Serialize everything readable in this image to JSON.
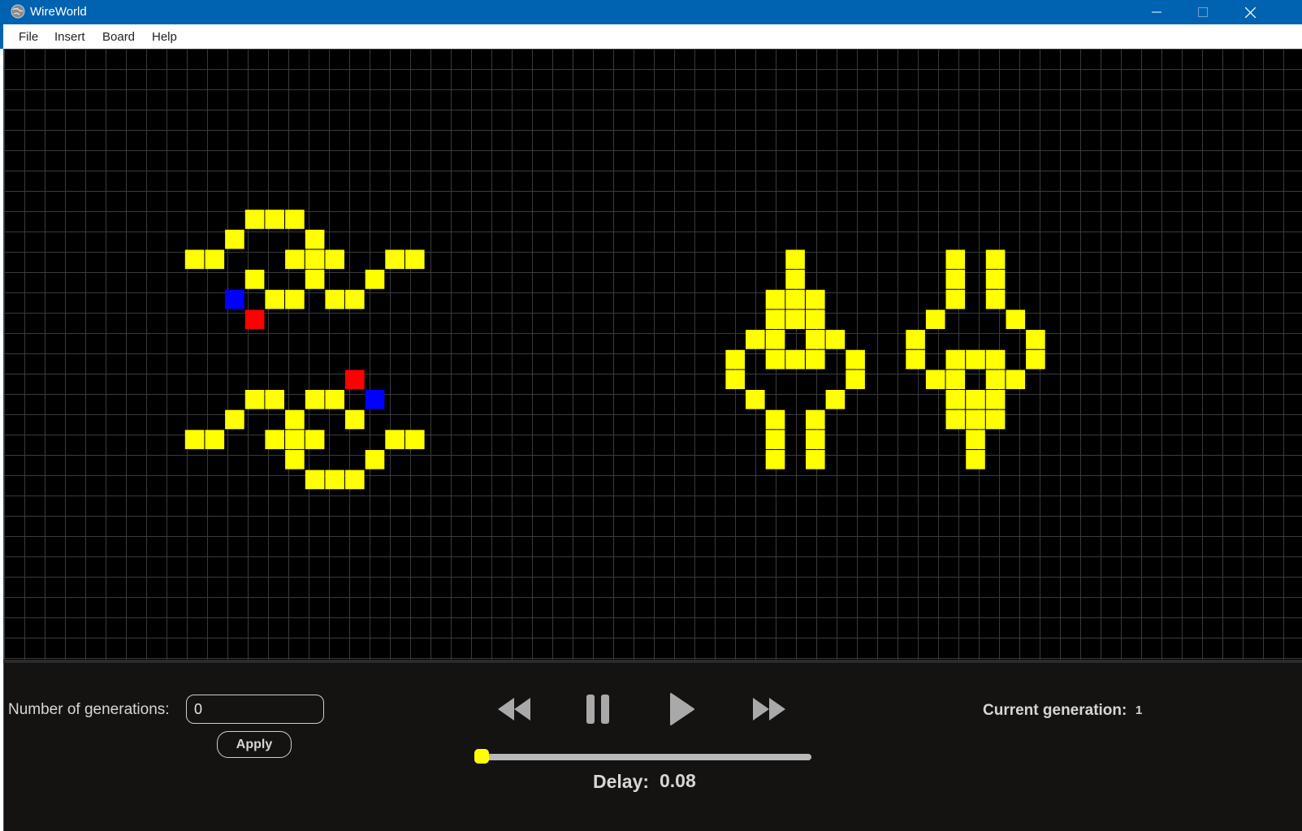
{
  "window": {
    "title": "WireWorld",
    "icon": "globe-icon",
    "controls": [
      "minimize-icon",
      "maximize-icon",
      "close-icon"
    ]
  },
  "menu": {
    "items": [
      {
        "label": "File"
      },
      {
        "label": "Insert"
      },
      {
        "label": "Board"
      },
      {
        "label": "Help"
      }
    ]
  },
  "board": {
    "colors": {
      "background": "#000000",
      "grid": "#3a3a3a",
      "conductor": "#ffff00",
      "electron_head": "#0000ff",
      "electron_tail": "#ff0000"
    },
    "conductor": [
      [
        12,
        8
      ],
      [
        13,
        8
      ],
      [
        14,
        8
      ],
      [
        11,
        9
      ],
      [
        15,
        9
      ],
      [
        9,
        10
      ],
      [
        10,
        10
      ],
      [
        14,
        10
      ],
      [
        15,
        10
      ],
      [
        16,
        10
      ],
      [
        19,
        10
      ],
      [
        20,
        10
      ],
      [
        12,
        11
      ],
      [
        15,
        11
      ],
      [
        18,
        11
      ],
      [
        13,
        12
      ],
      [
        14,
        12
      ],
      [
        16,
        12
      ],
      [
        17,
        12
      ],
      [
        12,
        17
      ],
      [
        13,
        17
      ],
      [
        15,
        17
      ],
      [
        16,
        17
      ],
      [
        11,
        18
      ],
      [
        14,
        18
      ],
      [
        17,
        18
      ],
      [
        9,
        19
      ],
      [
        10,
        19
      ],
      [
        13,
        19
      ],
      [
        14,
        19
      ],
      [
        15,
        19
      ],
      [
        19,
        19
      ],
      [
        20,
        19
      ],
      [
        14,
        20
      ],
      [
        18,
        20
      ],
      [
        15,
        21
      ],
      [
        16,
        21
      ],
      [
        17,
        21
      ],
      [
        39,
        10
      ],
      [
        39,
        11
      ],
      [
        38,
        12
      ],
      [
        39,
        12
      ],
      [
        40,
        12
      ],
      [
        38,
        13
      ],
      [
        39,
        13
      ],
      [
        40,
        13
      ],
      [
        37,
        14
      ],
      [
        38,
        14
      ],
      [
        40,
        14
      ],
      [
        41,
        14
      ],
      [
        36,
        15
      ],
      [
        38,
        15
      ],
      [
        39,
        15
      ],
      [
        40,
        15
      ],
      [
        42,
        15
      ],
      [
        36,
        16
      ],
      [
        42,
        16
      ],
      [
        37,
        17
      ],
      [
        41,
        17
      ],
      [
        38,
        18
      ],
      [
        40,
        18
      ],
      [
        38,
        19
      ],
      [
        40,
        19
      ],
      [
        38,
        20
      ],
      [
        40,
        20
      ],
      [
        47,
        10
      ],
      [
        49,
        10
      ],
      [
        47,
        11
      ],
      [
        49,
        11
      ],
      [
        47,
        12
      ],
      [
        49,
        12
      ],
      [
        46,
        13
      ],
      [
        50,
        13
      ],
      [
        45,
        14
      ],
      [
        51,
        14
      ],
      [
        45,
        15
      ],
      [
        47,
        15
      ],
      [
        48,
        15
      ],
      [
        49,
        15
      ],
      [
        51,
        15
      ],
      [
        46,
        16
      ],
      [
        47,
        16
      ],
      [
        49,
        16
      ],
      [
        50,
        16
      ],
      [
        47,
        17
      ],
      [
        48,
        17
      ],
      [
        49,
        17
      ],
      [
        47,
        18
      ],
      [
        48,
        18
      ],
      [
        49,
        18
      ],
      [
        48,
        19
      ],
      [
        48,
        20
      ]
    ],
    "heads": [
      [
        11,
        12
      ],
      [
        18,
        17
      ]
    ],
    "tails": [
      [
        12,
        13
      ],
      [
        17,
        16
      ]
    ]
  },
  "controls": {
    "generations_label": "Number of generations:",
    "generations_value": "0",
    "apply_label": "Apply",
    "playback": [
      "rewind-icon",
      "pause-icon",
      "play-icon",
      "fast-forward-icon"
    ],
    "current_generation_label": "Current generation:",
    "current_generation_value": "1",
    "delay_label": "Delay:",
    "delay_value": "0.08",
    "delay_slider_fraction": 0.0,
    "accent": "#ffff00"
  }
}
